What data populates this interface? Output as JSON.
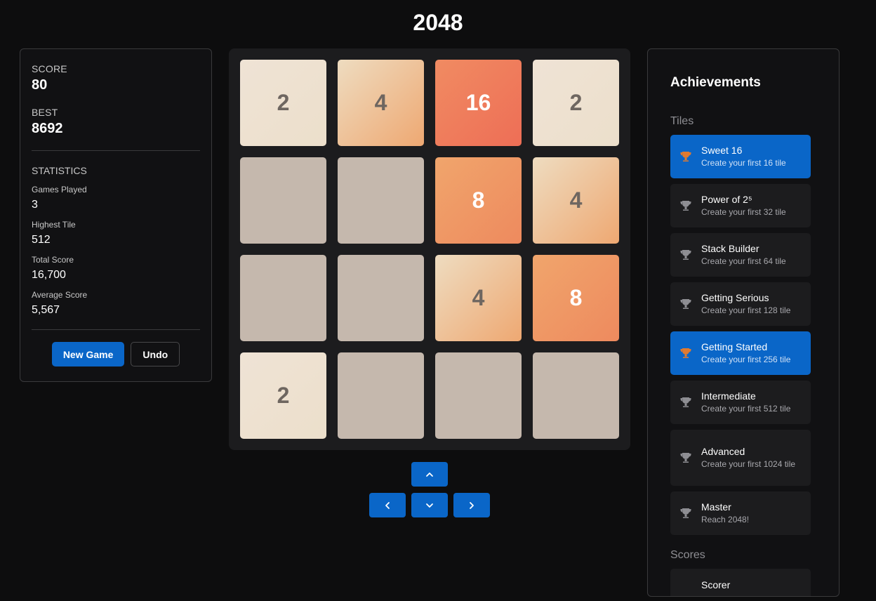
{
  "app": {
    "title": "2048"
  },
  "stats": {
    "score_label": "SCORE",
    "score": "80",
    "best_label": "BEST",
    "best": "8692",
    "statistics_label": "STATISTICS",
    "items": [
      {
        "label": "Games Played",
        "value": "3"
      },
      {
        "label": "Highest Tile",
        "value": "512"
      },
      {
        "label": "Total Score",
        "value": "16,700"
      },
      {
        "label": "Average Score",
        "value": "5,567"
      }
    ]
  },
  "controls": {
    "new_game_label": "New Game",
    "undo_label": "Undo"
  },
  "board": {
    "rows": [
      [
        "2",
        "4",
        "16",
        "2"
      ],
      [
        "",
        "",
        "8",
        "4"
      ],
      [
        "",
        "",
        "4",
        "8"
      ],
      [
        "2",
        "",
        "",
        ""
      ]
    ]
  },
  "arrows": {
    "up": "chevron-up-icon",
    "left": "chevron-left-icon",
    "down": "chevron-down-icon",
    "right": "chevron-right-icon"
  },
  "achievements": {
    "title": "Achievements",
    "tiles_label": "Tiles",
    "scores_label": "Scores",
    "items": [
      {
        "name": "Sweet 16",
        "desc": "Create your first 16 tile",
        "unlocked": true
      },
      {
        "name": "Power of 2⁵",
        "desc": "Create your first 32 tile",
        "unlocked": false
      },
      {
        "name": "Stack Builder",
        "desc": "Create your first 64 tile",
        "unlocked": false
      },
      {
        "name": "Getting Serious",
        "desc": "Create your first 128 tile",
        "unlocked": false
      },
      {
        "name": "Getting Started",
        "desc": "Create your first 256 tile",
        "unlocked": true
      },
      {
        "name": "Intermediate",
        "desc": "Create your first 512 tile",
        "unlocked": false
      },
      {
        "name": "Advanced",
        "desc": "Create your first 1024 tile",
        "unlocked": false
      },
      {
        "name": "Master",
        "desc": "Reach 2048!",
        "unlocked": false
      }
    ],
    "score_items": [
      {
        "name": "Scorer"
      }
    ]
  },
  "colors": {
    "accent": "#0a66c8",
    "trophy_unlocked": "#e07a2f",
    "trophy_locked": "#8e8e93",
    "empty_tile": "#c5b8ad"
  }
}
